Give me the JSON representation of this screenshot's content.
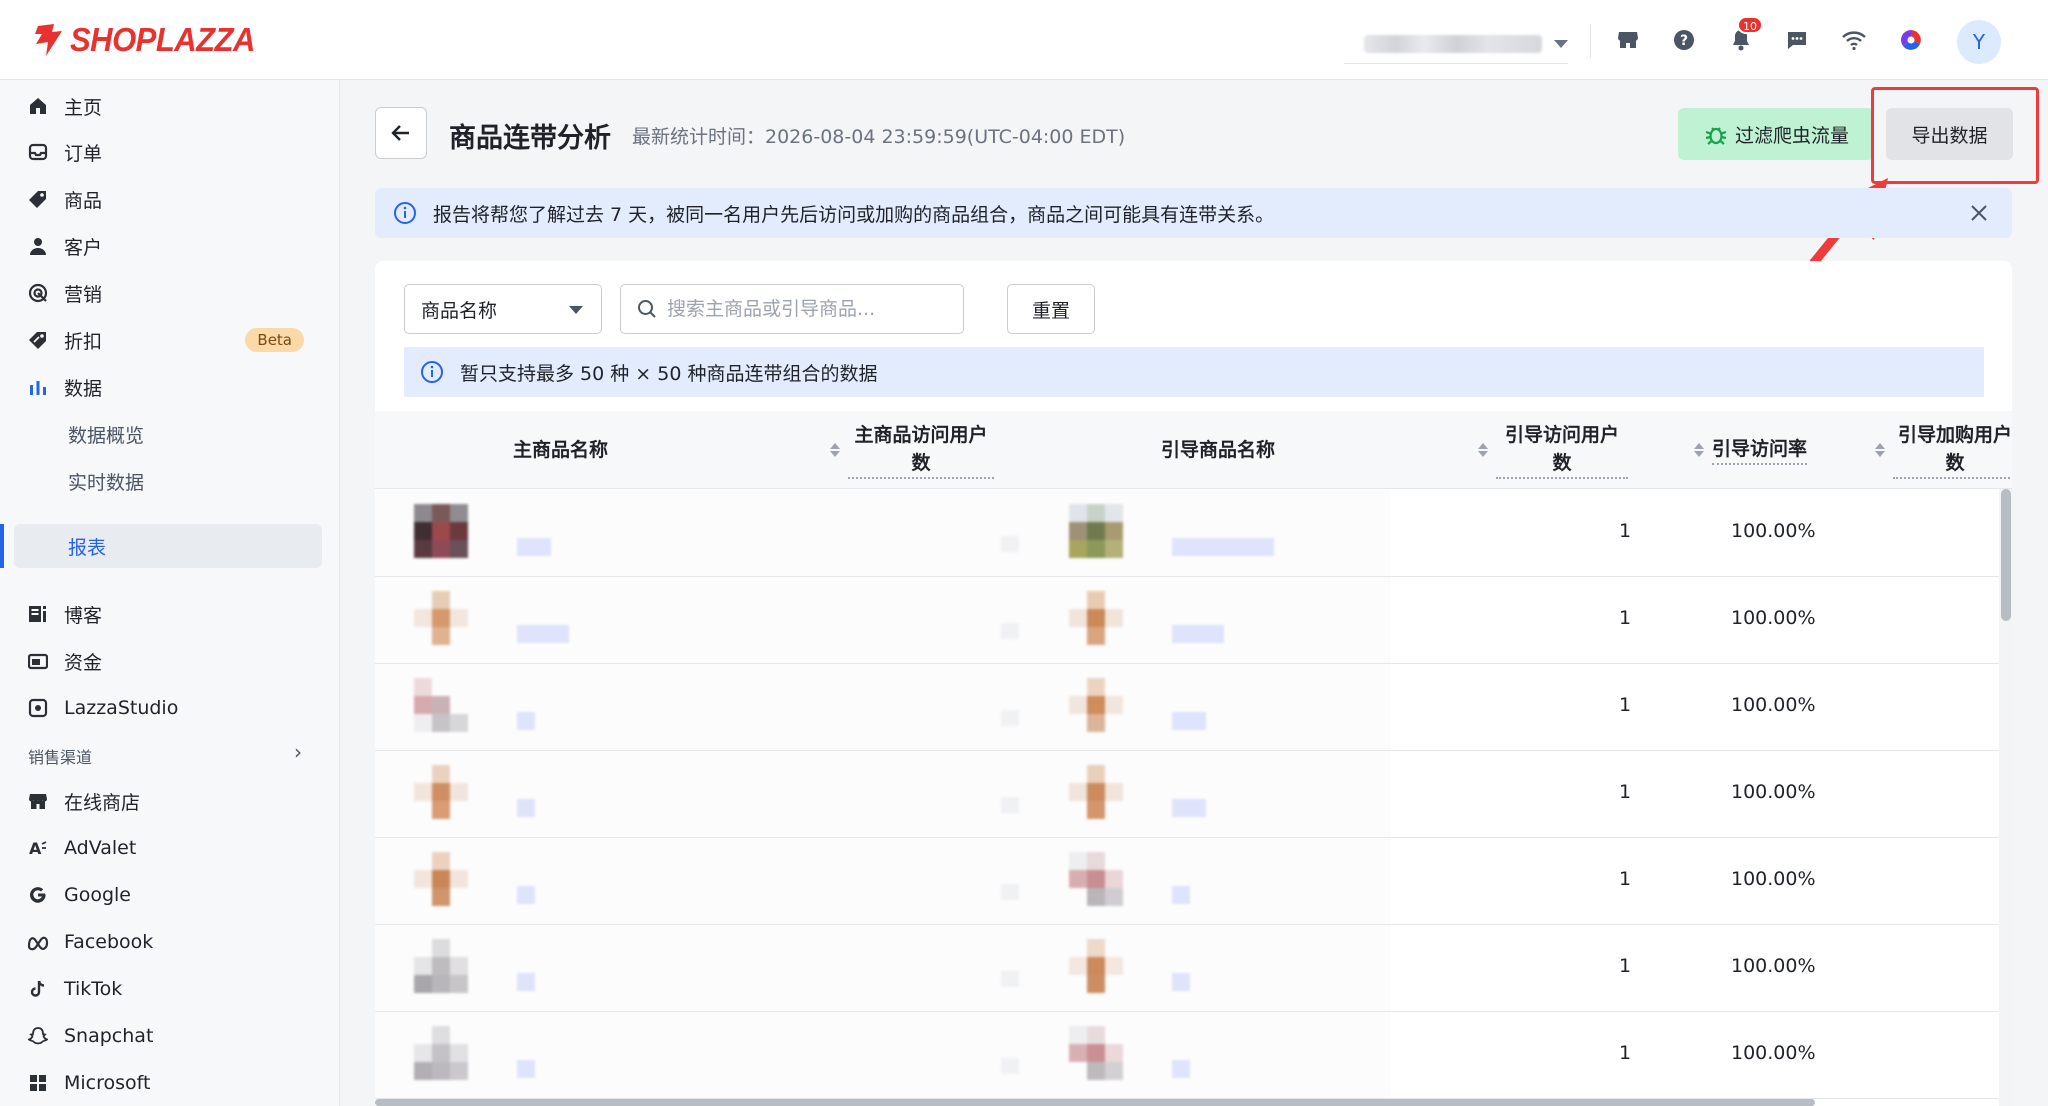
{
  "brand": {
    "name": "SHOPLAZZA",
    "color": "#e8322f"
  },
  "topbar": {
    "icons": [
      "store-icon",
      "help-icon",
      "bell-icon",
      "chat-icon",
      "wifi-icon",
      "color-wheel-icon"
    ],
    "notification_count": "10",
    "avatar_letter": "Y"
  },
  "sidebar": {
    "items": [
      {
        "label": "主页",
        "icon": "home-icon"
      },
      {
        "label": "订单",
        "icon": "inbox-icon"
      },
      {
        "label": "商品",
        "icon": "tag-icon"
      },
      {
        "label": "客户",
        "icon": "person-icon"
      },
      {
        "label": "营销",
        "icon": "target-icon"
      },
      {
        "label": "折扣",
        "icon": "discount-icon",
        "badge": "Beta"
      },
      {
        "label": "数据",
        "icon": "bar-chart-icon"
      }
    ],
    "sub_items": [
      {
        "label": "数据概览"
      },
      {
        "label": "实时数据"
      },
      {
        "label": "报表",
        "active": true
      }
    ],
    "items2": [
      {
        "label": "博客",
        "icon": "blog-icon"
      },
      {
        "label": "资金",
        "icon": "wallet-icon"
      },
      {
        "label": "LazzaStudio",
        "icon": "studio-icon"
      }
    ],
    "section_label": "销售渠道",
    "channels": [
      {
        "label": "在线商店",
        "icon": "store-icon"
      },
      {
        "label": "AdValet",
        "icon": "advalet-icon"
      },
      {
        "label": "Google",
        "icon": "google-icon"
      },
      {
        "label": "Facebook",
        "icon": "meta-icon"
      },
      {
        "label": "TikTok",
        "icon": "tiktok-icon"
      },
      {
        "label": "Snapchat",
        "icon": "snapchat-icon"
      },
      {
        "label": "Microsoft",
        "icon": "microsoft-icon"
      }
    ]
  },
  "header": {
    "title": "商品连带分析",
    "stat_time": "最新统计时间：2026-08-04 23:59:59(UTC-04:00 EDT)",
    "filter_bot_label": "过滤爬虫流量",
    "export_label": "导出数据"
  },
  "banner": {
    "text": "报告将帮您了解过去 7 天，被同一名用户先后访问或加购的商品组合，商品之间可能具有连带关系。"
  },
  "filters": {
    "select_value": "商品名称",
    "search_placeholder": "搜索主商品或引导商品...",
    "reset_label": "重置"
  },
  "notice": {
    "text": "暂只支持最多 50 种 × 50 种商品连带组合的数据"
  },
  "table": {
    "columns": [
      "主商品名称",
      "主商品访问用户数",
      "引导商品名称",
      "引导访问用户数",
      "引导访问率",
      "引导加购用户数"
    ],
    "rows": [
      {
        "guide_visitors": "1",
        "guide_rate": "100.00%"
      },
      {
        "guide_visitors": "1",
        "guide_rate": "100.00%"
      },
      {
        "guide_visitors": "1",
        "guide_rate": "100.00%"
      },
      {
        "guide_visitors": "1",
        "guide_rate": "100.00%"
      },
      {
        "guide_visitors": "1",
        "guide_rate": "100.00%"
      },
      {
        "guide_visitors": "1",
        "guide_rate": "100.00%"
      },
      {
        "guide_visitors": "1",
        "guide_rate": "100.00%"
      }
    ]
  },
  "colors": {
    "accent": "#2563eb",
    "highlight": "#ef3b3b",
    "banner_bg": "#e3ecfd",
    "green_button": "#bff2d3"
  }
}
